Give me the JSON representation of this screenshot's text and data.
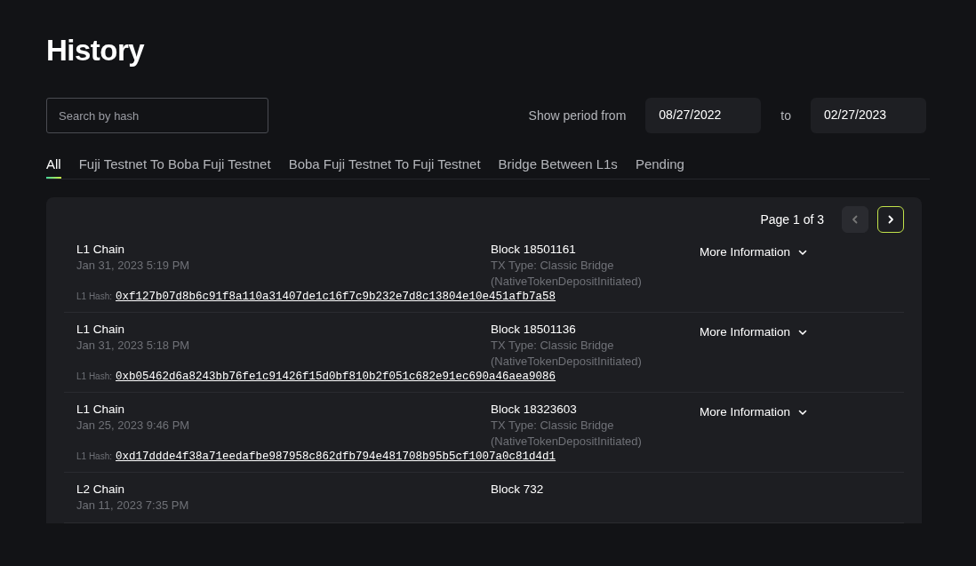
{
  "title": "History",
  "search": {
    "placeholder": "Search by hash"
  },
  "period": {
    "label": "Show period from",
    "from": "08/27/2022",
    "to_label": "to",
    "to": "02/27/2023"
  },
  "tabs": [
    {
      "label": "All",
      "selected": true
    },
    {
      "label": "Fuji Testnet To Boba Fuji Testnet",
      "selected": false
    },
    {
      "label": "Boba Fuji Testnet To Fuji Testnet",
      "selected": false
    },
    {
      "label": "Bridge Between L1s",
      "selected": false
    },
    {
      "label": "Pending",
      "selected": false
    }
  ],
  "pagination": {
    "label": "Page 1 of 3",
    "prev_disabled": true,
    "next_disabled": false
  },
  "transactions": [
    {
      "chain": "L1 Chain",
      "date": "Jan 31, 2023 5:19 PM",
      "block": "Block 18501161",
      "tx_type": "TX Type: Classic Bridge (NativeTokenDepositInitiated)",
      "more": "More Information",
      "hash_label": "L1 Hash:",
      "hash": "0xf127b07d8b6c91f8a110a31407de1c16f7c9b232e7d8c13804e10e451afb7a58"
    },
    {
      "chain": "L1 Chain",
      "date": "Jan 31, 2023 5:18 PM",
      "block": "Block 18501136",
      "tx_type": "TX Type: Classic Bridge (NativeTokenDepositInitiated)",
      "more": "More Information",
      "hash_label": "L1 Hash:",
      "hash": "0xb05462d6a8243bb76fe1c91426f15d0bf810b2f051c682e91ec690a46aea9086"
    },
    {
      "chain": "L1 Chain",
      "date": "Jan 25, 2023 9:46 PM",
      "block": "Block 18323603",
      "tx_type": "TX Type: Classic Bridge (NativeTokenDepositInitiated)",
      "more": "More Information",
      "hash_label": "L1 Hash:",
      "hash": "0xd17ddde4f38a71eedafbe987958c862dfb794e481708b95b5cf1007a0c81d4d1"
    },
    {
      "chain": "L2 Chain",
      "date": "Jan 11, 2023 7:35 PM",
      "block": "Block 732"
    }
  ]
}
